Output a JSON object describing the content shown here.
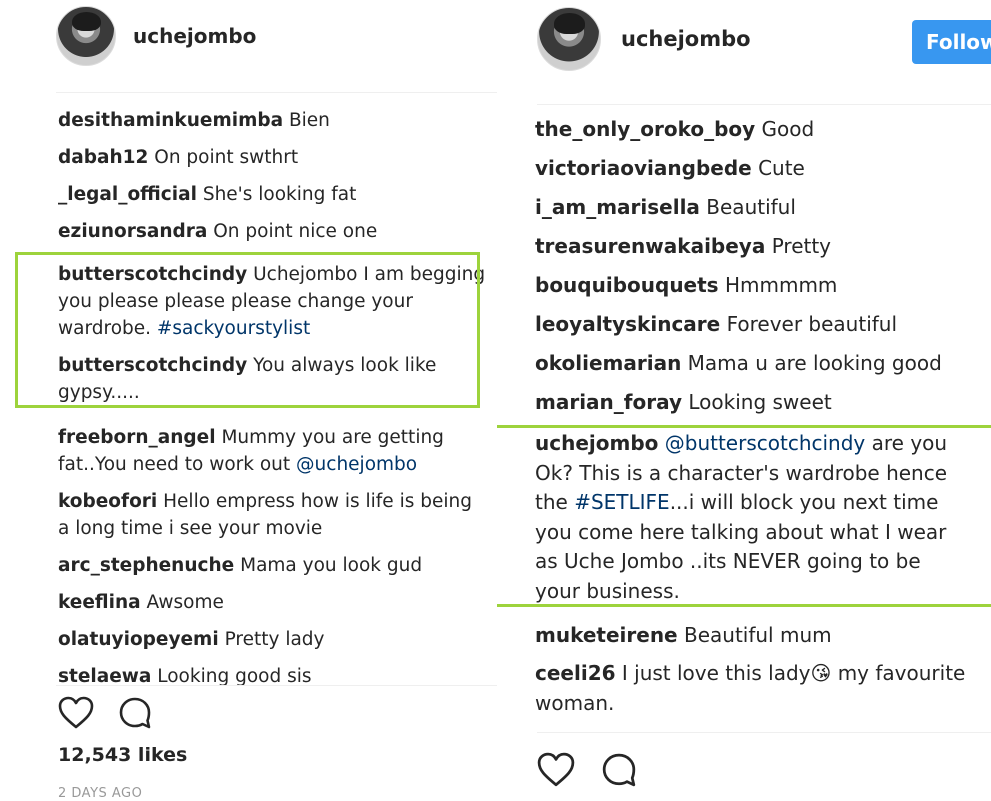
{
  "left": {
    "username": "uchejombo",
    "comments": [
      {
        "user": "desithaminkuemimba",
        "text": "Bien"
      },
      {
        "user": "dabah12",
        "text": "On point swthrt"
      },
      {
        "user": "_legal_official",
        "text": "She's looking fat"
      },
      {
        "user": "eziunorsandra",
        "text": "On point nice one"
      },
      {
        "user": "butterscotchcindy",
        "text": "Uchejombo I am begging you please please please change your wardrobe.",
        "tag": "#sackyourstylist"
      },
      {
        "user": "butterscotchcindy",
        "text": "You always look like gypsy....."
      },
      {
        "user": "freeborn_angel",
        "text": "Mummy you are getting fat..You need to work out",
        "tag": "@uchejombo"
      },
      {
        "user": "kobeofori",
        "text": "Hello empress how is life is being a long time i see your movie"
      },
      {
        "user": "arc_stephenuche",
        "text": "Mama you look gud"
      },
      {
        "user": "keeflina",
        "text": "Awsome"
      },
      {
        "user": "olatuyiopeyemi",
        "text": "Pretty lady"
      },
      {
        "user": "stelaewa",
        "text": "Looking good sis"
      }
    ],
    "likes": "12,543 likes",
    "time": "2 DAYS AGO"
  },
  "right": {
    "username": "uchejombo",
    "follow_label": "Follow",
    "comments": [
      {
        "user": "the_only_oroko_boy",
        "text": "Good"
      },
      {
        "user": "victoriaoviangbede",
        "text": "Cute"
      },
      {
        "user": "i_am_marisella",
        "text": "Beautiful"
      },
      {
        "user": "treasurenwakaibeya",
        "text": "Pretty"
      },
      {
        "user": "bouquibouquets",
        "text": "Hmmmmm"
      },
      {
        "user": "leoyaltyskincare",
        "text": "Forever beautiful"
      },
      {
        "user": "okoliemarian",
        "text": "Mama u are looking good"
      },
      {
        "user": "marian_foray",
        "text": "Looking sweet"
      },
      {
        "user": "uchejombo",
        "tag": "@butterscotchcindy",
        "text": "are you Ok? This is a character's wardrobe hence the",
        "tag2": "#SETLIFE",
        "text2": "...i will block you next time you come here talking about what I wear as Uche Jombo ..its NEVER going to be your business."
      },
      {
        "user": "muketeirene",
        "text": "Beautiful mum"
      },
      {
        "user": "ceeli26",
        "text": "I just love this lady",
        "emoji": "😘",
        "text2": "my favourite woman."
      }
    ]
  },
  "colors": {
    "highlight": "#9dd33c",
    "link": "#003569",
    "follow": "#3897f0"
  },
  "icons": [
    "heart-icon",
    "comment-icon"
  ]
}
